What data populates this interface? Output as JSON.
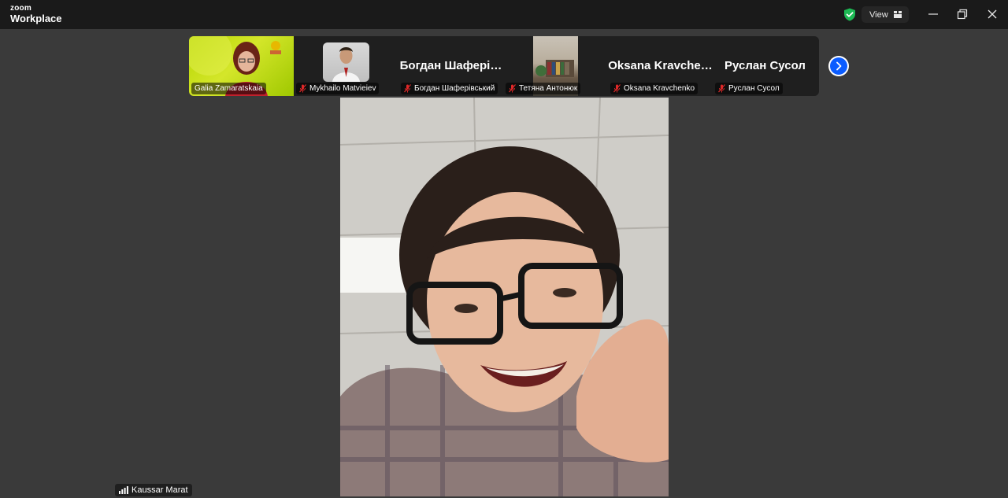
{
  "app": {
    "logo_top": "zoom",
    "logo_bottom": "Workplace",
    "view_label": "View"
  },
  "icons": {
    "shield": "shield-check-icon",
    "view": "grid-icon",
    "minimize": "minimize-icon",
    "restore": "restore-icon",
    "close": "close-icon",
    "next": "chevron-right-icon",
    "mute": "mic-muted-icon",
    "signal": "signal-bars-icon"
  },
  "colors": {
    "shield": "#1db954",
    "accent": "#0b5cff",
    "mute": "#e02828",
    "titlebar": "#1a1a1a",
    "background": "#3a3a3a"
  },
  "gallery": {
    "tiles": [
      {
        "name": "Galia Zamaratskaia",
        "display": "",
        "muted": false,
        "video": true
      },
      {
        "name": "Mykhailo Matvieiev",
        "display": "",
        "muted": true,
        "video": false
      },
      {
        "name": "Богдан Шаферівський",
        "display": "Богдан  Шафері…",
        "muted": true,
        "video": false
      },
      {
        "name": "Тетяна Антонюк",
        "display": "",
        "muted": true,
        "video": true
      },
      {
        "name": "Oksana Kravchenko",
        "display": "Oksana  Kravche…",
        "muted": true,
        "video": false
      },
      {
        "name": "Руслан Сусол",
        "display": "Руслан Сусол",
        "muted": true,
        "video": false
      }
    ]
  },
  "main": {
    "participant": "Kaussar Marat"
  }
}
